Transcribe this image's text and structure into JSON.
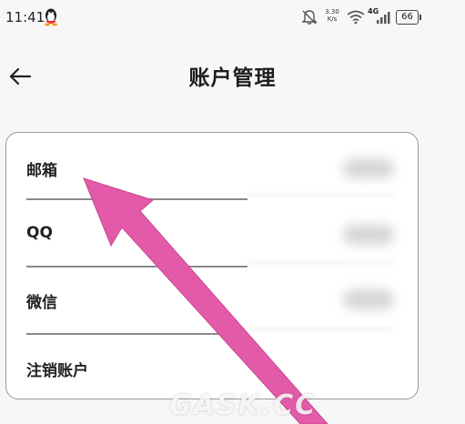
{
  "status_bar": {
    "time": "11:41",
    "net_speed_value": "3.30",
    "net_speed_unit": "K/s",
    "network_type": "4G",
    "battery": "66"
  },
  "header": {
    "title": "账户管理"
  },
  "account_items": [
    {
      "label": "邮箱"
    },
    {
      "label": "QQ"
    },
    {
      "label": "微信"
    },
    {
      "label": "注销账户"
    }
  ],
  "overlay": {
    "arrow_color": "#e25aa8",
    "watermark": "GASK.CC"
  }
}
